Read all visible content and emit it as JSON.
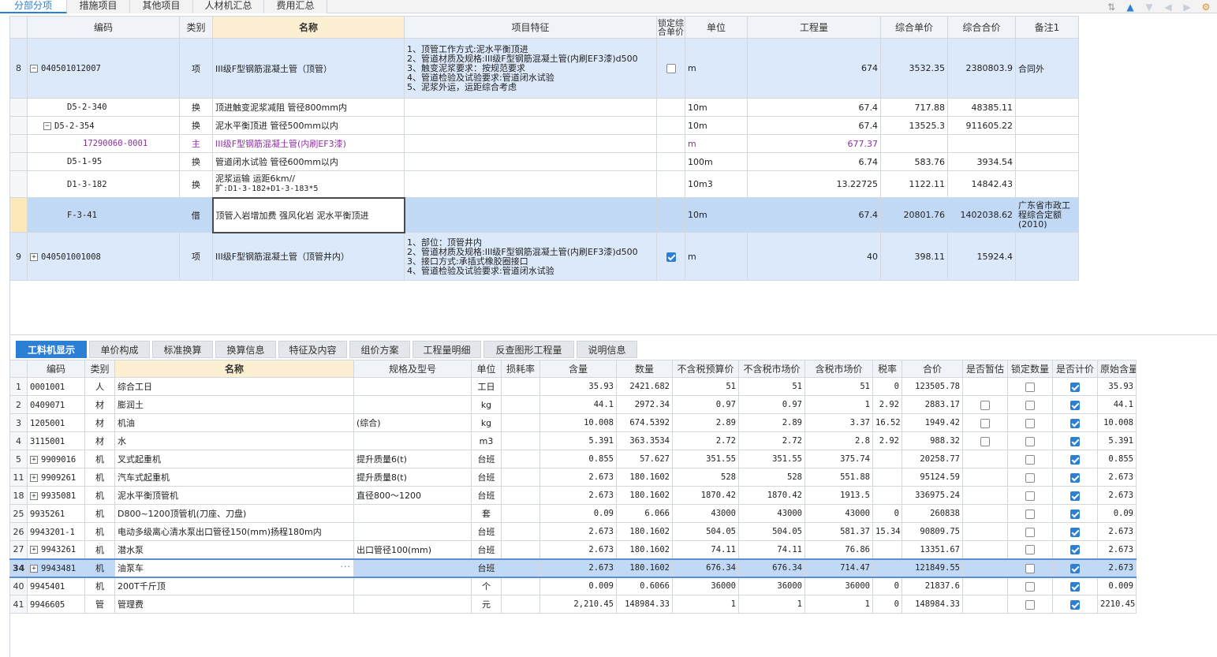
{
  "top_tabs": [
    {
      "label": "分部分项",
      "active": true
    },
    {
      "label": "措施项目",
      "active": false
    },
    {
      "label": "其他项目",
      "active": false
    },
    {
      "label": "人材机汇总",
      "active": false
    },
    {
      "label": "费用汇总",
      "active": false
    }
  ],
  "toolbar_icons": [
    "sort-icon",
    "arrow-up-icon",
    "arrow-down-icon",
    "arrow-left-icon",
    "arrow-right-icon",
    "settings-icon"
  ],
  "upper_headers": [
    "编码",
    "类别",
    "名称",
    "项目特征",
    "锁定综合单价",
    "单位",
    "工程量",
    "综合单价",
    "综合合价",
    "备注1"
  ],
  "upper_rows": [
    {
      "rn": "8",
      "code": "040501012007",
      "type": "项",
      "name": "III级F型钢筋混凝土管（顶管）",
      "features": [
        "1、顶管工作方式:泥水平衡顶进",
        "2、管道材质及规格:III级F型钢筋混凝土管(内刷EF3漆)d500",
        "3、触变泥浆要求：按规范要求",
        "4、管道检验及试验要求:管道闭水试验",
        "5、泥浆外运，运距综合考虑"
      ],
      "unit": "m",
      "qty": "674",
      "price": "3532.35",
      "total": "2380803.9",
      "note": "合同外"
    },
    {
      "rn": "",
      "code": "D5-2-340",
      "type": "换",
      "name": "顶进触变泥浆减阻 管径800mm内",
      "unit": "10m",
      "qty": "67.4",
      "price": "717.88",
      "total": "48385.11",
      "note": ""
    },
    {
      "rn": "",
      "code": "D5-2-354",
      "type": "换",
      "name": "泥水平衡顶进 管径500mm以内",
      "unit": "10m",
      "qty": "67.4",
      "price": "13525.3",
      "total": "911605.22",
      "note": ""
    },
    {
      "rn": "",
      "code": "17290060-0001",
      "type": "主",
      "name": "III级F型钢筋混凝土管(内刷EF3漆)",
      "unit": "m",
      "qty": "677.37",
      "price": "",
      "total": "",
      "note": ""
    },
    {
      "rn": "",
      "code": "D5-1-95",
      "type": "换",
      "name": "管道闭水试验 管径600mm以内",
      "unit": "100m",
      "qty": "6.74",
      "price": "583.76",
      "total": "3934.54",
      "note": ""
    },
    {
      "rn": "",
      "code": "D1-3-182",
      "type": "换",
      "name": "泥浆运输 运距6km//",
      "name2": "扩:D1-3-182+D1-3-183*5",
      "unit": "10m3",
      "qty": "13.22725",
      "price": "1122.11",
      "total": "14842.43",
      "note": ""
    },
    {
      "rn": "",
      "code": "F-3-41",
      "type": "借",
      "name": "顶管入岩增加费 强风化岩 泥水平衡顶进",
      "unit": "10m",
      "qty": "67.4",
      "price": "20801.76",
      "total": "1402038.62",
      "note": "广东省市政工程综合定额(2010)"
    },
    {
      "rn": "9",
      "code": "040501001008",
      "type": "项",
      "name": "III级F型钢筋混凝土管（顶管井内）",
      "features": [
        "1、部位：顶管井内",
        "2、管道材质及规格:III级F型钢筋混凝土管(内刷EF3漆)d500",
        "3、接口方式:承插式橡胶圈接口",
        "4、管道检验及试验要求:管道闭水试验"
      ],
      "unit": "m",
      "qty": "40",
      "price": "398.11",
      "total": "15924.4",
      "note": ""
    }
  ],
  "lower_tabs": [
    {
      "label": "工料机显示",
      "active": true
    },
    {
      "label": "单价构成",
      "active": false
    },
    {
      "label": "标准换算",
      "active": false
    },
    {
      "label": "换算信息",
      "active": false
    },
    {
      "label": "特征及内容",
      "active": false
    },
    {
      "label": "组价方案",
      "active": false
    },
    {
      "label": "工程量明细",
      "active": false
    },
    {
      "label": "反查图形工程量",
      "active": false
    },
    {
      "label": "说明信息",
      "active": false
    }
  ],
  "lower_headers": [
    "编码",
    "类别",
    "名称",
    "规格及型号",
    "单位",
    "损耗率",
    "含量",
    "数量",
    "不含税预算价",
    "不含税市场价",
    "含税市场价",
    "税率",
    "合价",
    "是否暂估",
    "锁定数量",
    "是否计价",
    "原始含量"
  ],
  "lower_rows": [
    {
      "rn": "1",
      "code": "0001001",
      "type": "人",
      "name": "综合工日",
      "spec": "",
      "unit": "工日",
      "loss": "",
      "content": "35.93",
      "qty": "2421.682",
      "p1": "51",
      "p2": "51",
      "p3": "51",
      "tax": "0",
      "total": "123505.78",
      "orig": "35.93"
    },
    {
      "rn": "2",
      "code": "0409071",
      "type": "材",
      "name": "膨润土",
      "spec": "",
      "unit": "kg",
      "loss": "",
      "content": "44.1",
      "qty": "2972.34",
      "p1": "0.97",
      "p2": "0.97",
      "p3": "1",
      "tax": "2.92",
      "total": "2883.17",
      "orig": "44.1"
    },
    {
      "rn": "3",
      "code": "1205001",
      "type": "材",
      "name": "机油",
      "spec": "(综合)",
      "unit": "kg",
      "loss": "",
      "content": "10.008",
      "qty": "674.5392",
      "p1": "2.89",
      "p2": "2.89",
      "p3": "3.37",
      "tax": "16.52",
      "total": "1949.42",
      "orig": "10.008"
    },
    {
      "rn": "4",
      "code": "3115001",
      "type": "材",
      "name": "水",
      "spec": "",
      "unit": "m3",
      "loss": "",
      "content": "5.391",
      "qty": "363.3534",
      "p1": "2.72",
      "p2": "2.72",
      "p3": "2.8",
      "tax": "2.92",
      "total": "988.32",
      "orig": "5.391"
    },
    {
      "rn": "5",
      "code": "9909016",
      "type": "机",
      "name": "叉式起重机",
      "spec": "提升质量6(t)",
      "unit": "台班",
      "loss": "",
      "content": "0.855",
      "qty": "57.627",
      "p1": "351.55",
      "p2": "351.55",
      "p3": "375.74",
      "tax": "",
      "total": "20258.77",
      "orig": "0.855"
    },
    {
      "rn": "11",
      "code": "9909261",
      "type": "机",
      "name": "汽车式起重机",
      "spec": "提升质量8(t)",
      "unit": "台班",
      "loss": "",
      "content": "2.673",
      "qty": "180.1602",
      "p1": "528",
      "p2": "528",
      "p3": "551.88",
      "tax": "",
      "total": "95124.59",
      "orig": "2.673"
    },
    {
      "rn": "18",
      "code": "9935081",
      "type": "机",
      "name": "泥水平衡顶管机",
      "spec": "直径800～1200",
      "unit": "台班",
      "loss": "",
      "content": "2.673",
      "qty": "180.1602",
      "p1": "1870.42",
      "p2": "1870.42",
      "p3": "1913.5",
      "tax": "",
      "total": "336975.24",
      "orig": "2.673"
    },
    {
      "rn": "25",
      "code": "9935261",
      "type": "机",
      "name": "D800~1200顶管机(刀座、刀盘)",
      "spec": "",
      "unit": "套",
      "loss": "",
      "content": "0.09",
      "qty": "6.066",
      "p1": "43000",
      "p2": "43000",
      "p3": "43000",
      "tax": "0",
      "total": "260838",
      "orig": "0.09"
    },
    {
      "rn": "26",
      "code": "9943201-1",
      "type": "机",
      "name": "电动多级离心清水泵出口管径150(mm)扬程180m内",
      "spec": "",
      "unit": "台班",
      "loss": "",
      "content": "2.673",
      "qty": "180.1602",
      "p1": "504.05",
      "p2": "504.05",
      "p3": "581.37",
      "tax": "15.34",
      "total": "90809.75",
      "orig": "2.673"
    },
    {
      "rn": "27",
      "code": "9943261",
      "type": "机",
      "name": "潜水泵",
      "spec": "出口管径100(mm)",
      "unit": "台班",
      "loss": "",
      "content": "2.673",
      "qty": "180.1602",
      "p1": "74.11",
      "p2": "74.11",
      "p3": "76.86",
      "tax": "",
      "total": "13351.67",
      "orig": "2.673"
    },
    {
      "rn": "34",
      "code": "9943481",
      "type": "机",
      "name": "油泵车",
      "spec": "",
      "unit": "台班",
      "loss": "",
      "content": "2.673",
      "qty": "180.1602",
      "p1": "676.34",
      "p2": "676.34",
      "p3": "714.47",
      "tax": "",
      "total": "121849.55",
      "orig": "2.673"
    },
    {
      "rn": "40",
      "code": "9945401",
      "type": "机",
      "name": "200T千斤顶",
      "spec": "",
      "unit": "个",
      "loss": "",
      "content": "0.009",
      "qty": "0.6066",
      "p1": "36000",
      "p2": "36000",
      "p3": "36000",
      "tax": "0",
      "total": "21837.6",
      "orig": "0.009"
    },
    {
      "rn": "41",
      "code": "9946605",
      "type": "管",
      "name": "管理费",
      "spec": "",
      "unit": "元",
      "loss": "",
      "content": "2,210.45",
      "qty": "148984.33",
      "p1": "1",
      "p2": "1",
      "p3": "1",
      "tax": "0",
      "total": "148984.33",
      "orig": "2210.45"
    }
  ],
  "colors": {
    "accent": "#2b7fd4",
    "row_highlight": "#dce9fb",
    "row_selected": "#c2d9f6",
    "header_highlight": "#fdf0d2",
    "main_material_text": "#8e2ea6"
  }
}
